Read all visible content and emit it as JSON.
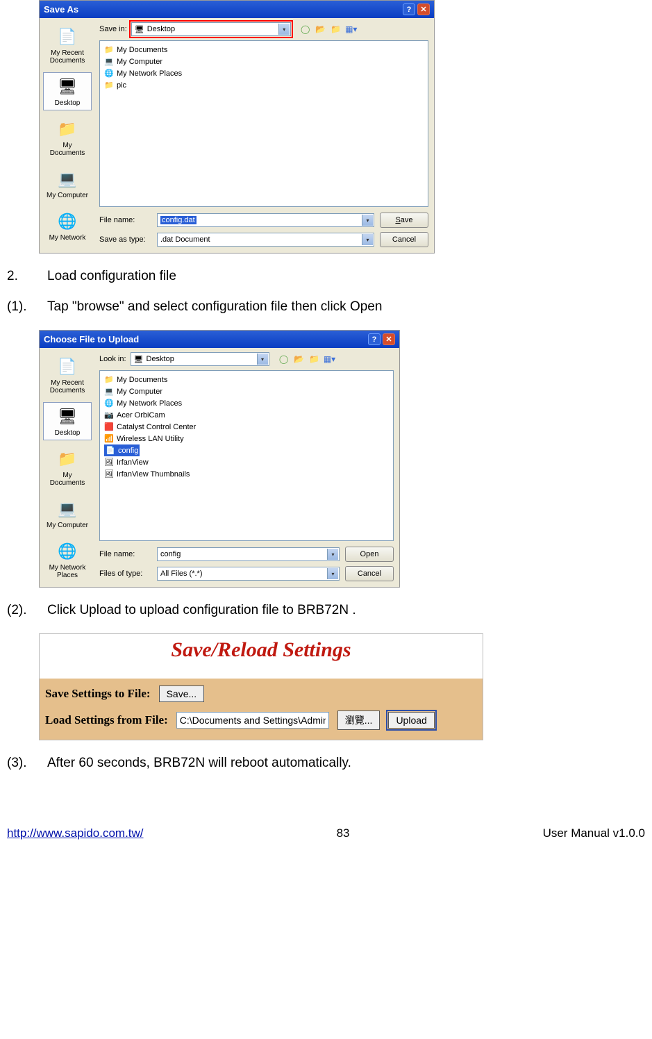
{
  "dlg1": {
    "title": "Save As",
    "look_label": "Save in:",
    "look_value": "Desktop",
    "places": [
      {
        "label": "My Recent Documents",
        "icon": "📄"
      },
      {
        "label": "Desktop",
        "icon": "🖥",
        "selected": true
      },
      {
        "label": "My Documents",
        "icon": "📁"
      },
      {
        "label": "My Computer",
        "icon": "💻"
      },
      {
        "label": "My Network",
        "icon": "🌐"
      }
    ],
    "files": [
      {
        "icon": "📁",
        "label": "My Documents"
      },
      {
        "icon": "💻",
        "label": "My Computer"
      },
      {
        "icon": "🌐",
        "label": "My Network Places"
      },
      {
        "icon": "📁",
        "label": "pic"
      }
    ],
    "filename_label": "File name:",
    "filename_value": "config.dat",
    "type_label": "Save as type:",
    "type_value": ".dat Document",
    "btn_primary": "Save",
    "btn_secondary": "Cancel"
  },
  "step2": {
    "num": "2.",
    "text": "Load configuration file"
  },
  "sub1": {
    "num": "(1).",
    "text": "Tap \"browse\" and select configuration file then click Open"
  },
  "dlg2": {
    "title": "Choose File to Upload",
    "look_label": "Look in:",
    "look_value": "Desktop",
    "places": [
      {
        "label": "My Recent Documents",
        "icon": "📄"
      },
      {
        "label": "Desktop",
        "icon": "🖥",
        "selected": true
      },
      {
        "label": "My Documents",
        "icon": "📁"
      },
      {
        "label": "My Computer",
        "icon": "💻"
      },
      {
        "label": "My Network Places",
        "icon": "🌐"
      }
    ],
    "files": [
      {
        "icon": "📁",
        "label": "My Documents"
      },
      {
        "icon": "💻",
        "label": "My Computer"
      },
      {
        "icon": "🌐",
        "label": "My Network Places"
      },
      {
        "icon": "📷",
        "label": "Acer OrbiCam"
      },
      {
        "icon": "🟥",
        "label": "Catalyst Control Center"
      },
      {
        "icon": "📶",
        "label": "Wireless LAN Utility"
      },
      {
        "icon": "📄",
        "label": "config",
        "selected": true
      },
      {
        "icon": "🖼",
        "label": "IrfanView"
      },
      {
        "icon": "🖼",
        "label": "IrfanView Thumbnails"
      }
    ],
    "filename_label": "File name:",
    "filename_value": "config",
    "type_label": "Files of type:",
    "type_value": "All Files (*.*)",
    "btn_primary": "Open",
    "btn_secondary": "Cancel"
  },
  "sub2": {
    "num": "(2).",
    "text": "Click Upload to upload configuration file to BRB72N ."
  },
  "srs": {
    "title": "Save/Reload Settings",
    "row1_label": "Save Settings to File:",
    "save_btn": "Save...",
    "row2_label": "Load Settings from File:",
    "path_value": "C:\\Documents and Settings\\Adminis",
    "browse_btn": "瀏覽...",
    "upload_btn": "Upload"
  },
  "sub3": {
    "num": "(3).",
    "text": "After 60 seconds, BRB72N will reboot automatically."
  },
  "footer": {
    "left": "http://www.sapido.com.tw/",
    "center": "83",
    "right": "User Manual v1.0.0"
  }
}
